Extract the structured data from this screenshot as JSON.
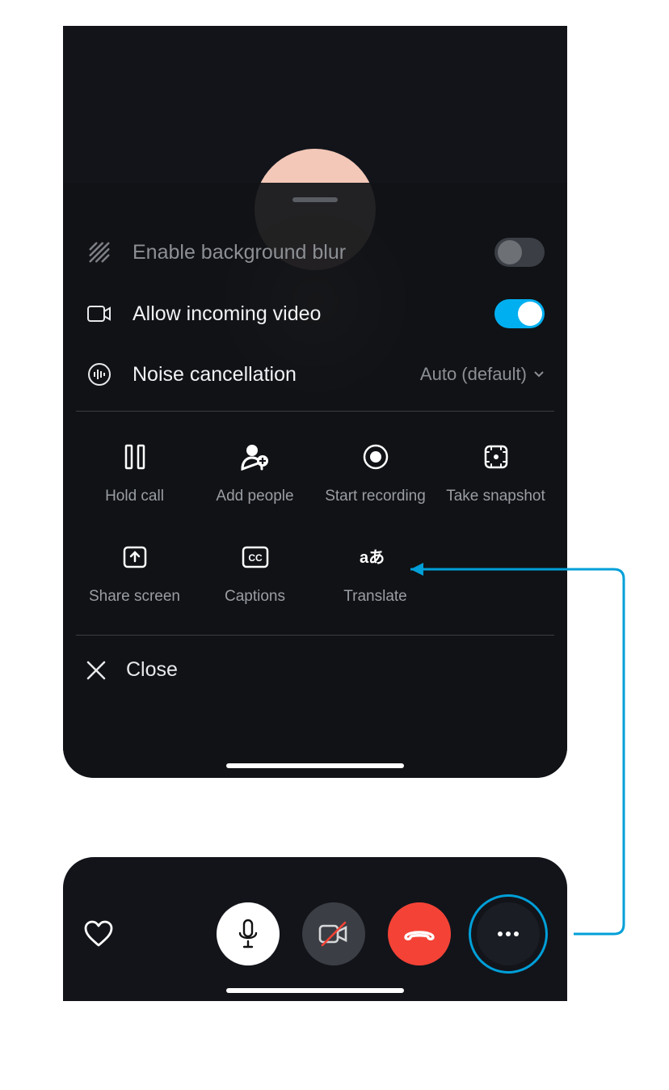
{
  "settings": {
    "blur": {
      "label": "Enable background blur",
      "enabled": false
    },
    "video": {
      "label": "Allow incoming video",
      "enabled": true
    },
    "noise": {
      "label": "Noise cancellation",
      "value": "Auto (default)"
    }
  },
  "actions": {
    "hold": "Hold call",
    "add": "Add people",
    "record": "Start recording",
    "snapshot": "Take snapshot",
    "share": "Share screen",
    "captions": "Captions",
    "translate": "Translate"
  },
  "close_label": "Close",
  "colors": {
    "accent": "#00aff0",
    "hangup": "#f44336",
    "annotation": "#009fd8"
  }
}
